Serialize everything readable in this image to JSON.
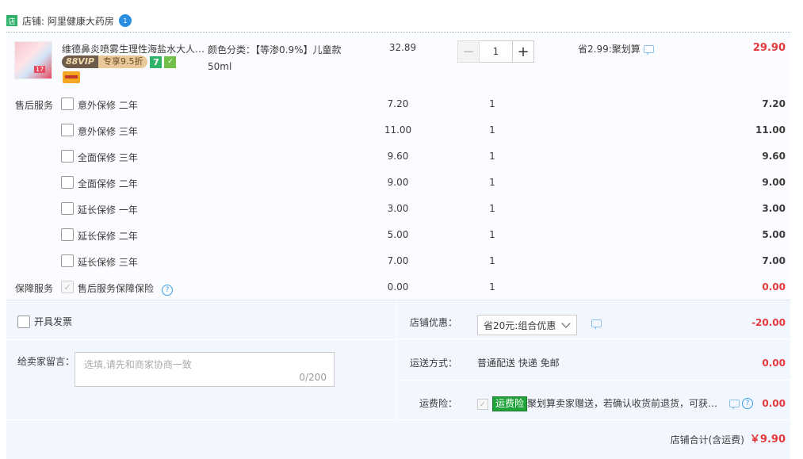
{
  "shop": {
    "icon_text": "店",
    "label": "店铺: 阿里健康大药房",
    "badge": "1"
  },
  "product": {
    "title": "维德鼻炎喷雾生理性海盐水大人儿童洗鼻器",
    "img_tag": "17",
    "vip_left": "88VIP",
    "vip_right": "专享9.5折",
    "seven_label": "7",
    "sku_label": "颜色分类：【等渗0.9%】儿童款50ml",
    "unit_price": "32.89",
    "quantity": "1",
    "promo": "省2.99:聚划算",
    "total": "29.90"
  },
  "services": [
    {
      "label": "售后服务",
      "name": "意外保修 二年",
      "price": "7.20",
      "qty": "1",
      "total": "7.20"
    },
    {
      "label": "",
      "name": "意外保修 三年",
      "price": "11.00",
      "qty": "1",
      "total": "11.00"
    },
    {
      "label": "",
      "name": "全面保修 三年",
      "price": "9.60",
      "qty": "1",
      "total": "9.60"
    },
    {
      "label": "",
      "name": "全面保修 二年",
      "price": "9.00",
      "qty": "1",
      "total": "9.00"
    },
    {
      "label": "",
      "name": "延长保修 一年",
      "price": "3.00",
      "qty": "1",
      "total": "3.00"
    },
    {
      "label": "",
      "name": "延长保修 二年",
      "price": "5.00",
      "qty": "1",
      "total": "5.00"
    },
    {
      "label": "",
      "name": "延长保修 三年",
      "price": "7.00",
      "qty": "1",
      "total": "7.00"
    },
    {
      "label": "保障服务",
      "name": "售后服务保障保险",
      "price": "0.00",
      "qty": "1",
      "total": "0.00"
    }
  ],
  "invoice": {
    "label": "开具发票"
  },
  "message": {
    "label": "给卖家留言：",
    "placeholder": "选填,请先和商家协商一致",
    "counter": "0/200"
  },
  "discount": {
    "label": "店铺优惠：",
    "selected": "省20元:组合优惠",
    "value": "-20.00"
  },
  "shipping": {
    "label": "运送方式：",
    "method": "普通配送 快递 免邮",
    "value": "0.00"
  },
  "insurance": {
    "label": "运费险：",
    "badge": "运费险",
    "text": "聚划算卖家赠送，若确认收货前退货，可获保险赔付",
    "value": "0.00"
  },
  "total": {
    "label": "店铺合计(含运费)",
    "value": "￥9.90"
  },
  "colors": {
    "accent_red": "#e4393c",
    "panel_bg": "#f2f7ff",
    "green": "#21a33a"
  }
}
